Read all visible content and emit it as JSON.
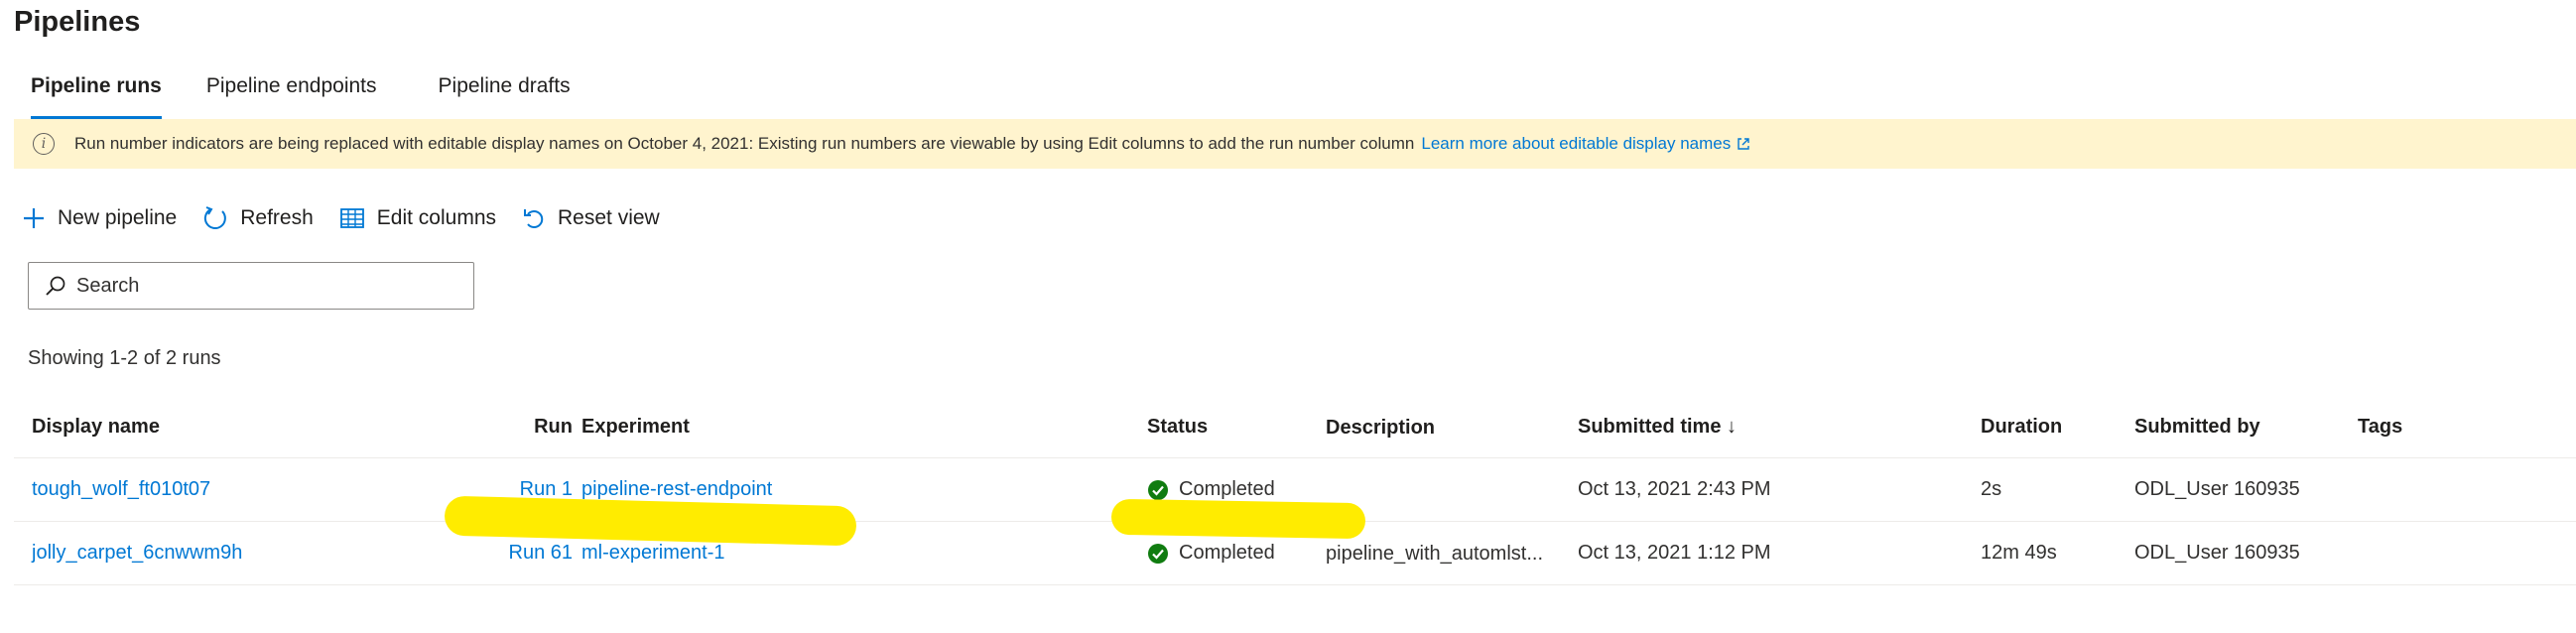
{
  "page": {
    "title": "Pipelines"
  },
  "tabs": [
    {
      "label": "Pipeline runs",
      "active": true
    },
    {
      "label": "Pipeline endpoints",
      "active": false
    },
    {
      "label": "Pipeline drafts",
      "active": false
    }
  ],
  "banner": {
    "icon": "info-icon",
    "message": "Run number indicators are being replaced with editable display names on October 4, 2021: Existing run numbers are viewable by using Edit columns to add the run number column",
    "link_label": "Learn more about editable display names",
    "link_icon": "external-link-icon",
    "background": "#fff4ce"
  },
  "toolbar": {
    "new_pipeline": "New pipeline",
    "refresh": "Refresh",
    "edit_columns": "Edit columns",
    "reset_view": "Reset view"
  },
  "search": {
    "placeholder": "Search",
    "value": ""
  },
  "summary": {
    "text": "Showing 1-2 of 2 runs"
  },
  "table": {
    "columns": [
      "Display name",
      "Run",
      "Experiment",
      "Status",
      "Description",
      "Submitted time ↓",
      "Duration",
      "Submitted by",
      "Tags"
    ],
    "rows": [
      {
        "display_name": "tough_wolf_ft010t07",
        "run": "Run 1",
        "experiment": "pipeline-rest-endpoint",
        "status": "Completed",
        "description": "",
        "submitted_time": "Oct 13, 2021 2:43 PM",
        "duration": "2s",
        "submitted_by": "ODL_User 160935",
        "tags": ""
      },
      {
        "display_name": "jolly_carpet_6cnwwm9h",
        "run": "Run 61",
        "experiment": "ml-experiment-1",
        "status": "Completed",
        "description": "pipeline_with_automlst...",
        "submitted_time": "Oct 13, 2021 1:12 PM",
        "duration": "12m 49s",
        "submitted_by": "ODL_User 160935",
        "tags": ""
      }
    ]
  },
  "colors": {
    "accent": "#0078d4",
    "success": "#107c10",
    "highlight": "#ffec00"
  }
}
